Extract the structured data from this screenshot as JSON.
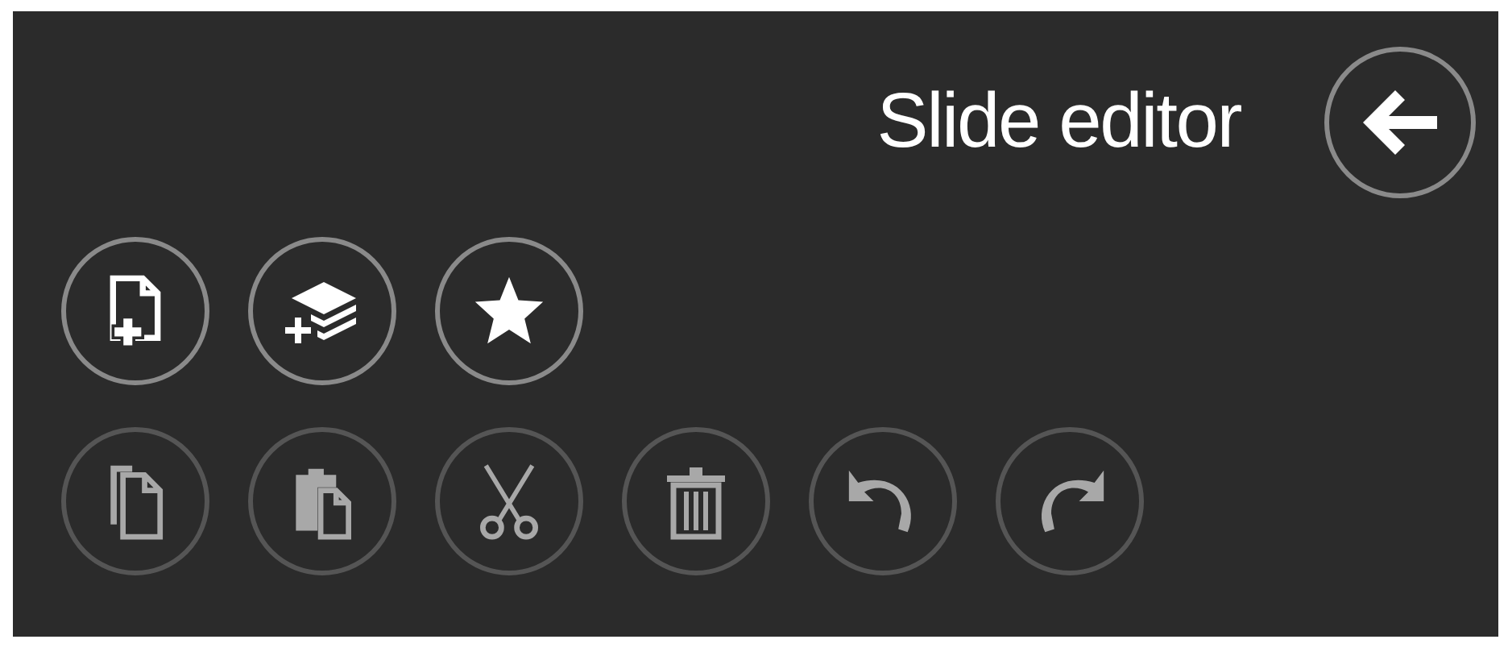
{
  "header": {
    "title": "Slide editor"
  },
  "toolbar_rows": [
    {
      "buttons": [
        {
          "kind": "new-slide",
          "disabled": false
        },
        {
          "kind": "layers-add",
          "disabled": false
        },
        {
          "kind": "star",
          "disabled": false
        }
      ]
    },
    {
      "buttons": [
        {
          "kind": "copy",
          "disabled": true
        },
        {
          "kind": "paste",
          "disabled": true
        },
        {
          "kind": "cut",
          "disabled": true
        },
        {
          "kind": "delete",
          "disabled": true
        },
        {
          "kind": "undo",
          "disabled": true
        },
        {
          "kind": "redo",
          "disabled": true
        }
      ]
    }
  ]
}
